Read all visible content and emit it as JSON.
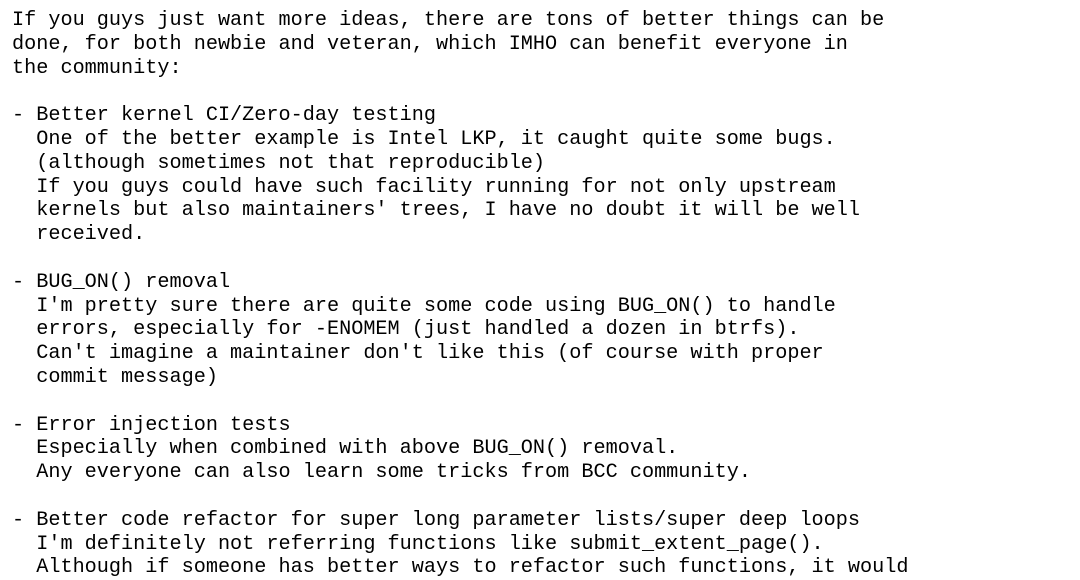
{
  "document": {
    "type": "plain-text-message",
    "background_color": "#ffffff",
    "text_color": "#000000",
    "font_style": "monospace",
    "lines": [
      "If you guys just want more ideas, there are tons of better things can be",
      "done, for both newbie and veteran, which IMHO can benefit everyone in",
      "the community:",
      "",
      "- Better kernel CI/Zero-day testing",
      "  One of the better example is Intel LKP, it caught quite some bugs.",
      "  (although sometimes not that reproducible)",
      "  If you guys could have such facility running for not only upstream",
      "  kernels but also maintainers' trees, I have no doubt it will be well",
      "  received.",
      "",
      "- BUG_ON() removal",
      "  I'm pretty sure there are quite some code using BUG_ON() to handle",
      "  errors, especially for -ENOMEM (just handled a dozen in btrfs).",
      "  Can't imagine a maintainer don't like this (of course with proper",
      "  commit message)",
      "",
      "- Error injection tests",
      "  Especially when combined with above BUG_ON() removal.",
      "  Any everyone can also learn some tricks from BCC community.",
      "",
      "- Better code refactor for super long parameter lists/super deep loops",
      "  I'm definitely not referring functions like submit_extent_page().",
      "  Although if someone has better ways to refactor such functions, it would"
    ]
  }
}
